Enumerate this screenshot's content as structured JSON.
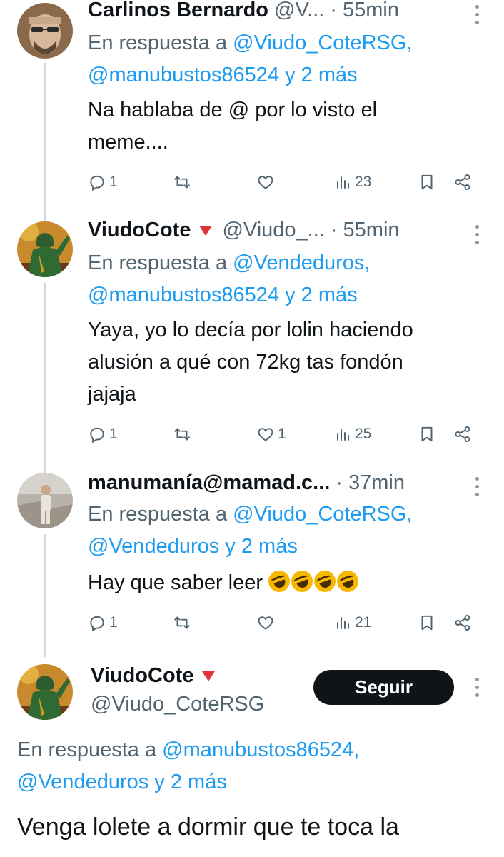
{
  "tweets": [
    {
      "name": "Carlinos Bernardo",
      "handle": "@V...",
      "dot": "·",
      "time": "55min",
      "reply_prefix": "En respuesta a",
      "reply_mentions_1": "@Viudo_CoteRSG,",
      "reply_mentions_2": "@manubustos86524 y 2 más",
      "text_1": "Na hablaba de @ por lo visto el",
      "text_2": "meme....",
      "replies": "1",
      "retweets": "",
      "likes": "",
      "views": "23"
    },
    {
      "name": "ViudoCote",
      "handle": "@Viudo_...",
      "dot": "·",
      "time": "55min",
      "reply_prefix": "En respuesta a",
      "reply_mentions_1": "@Vendeduros,",
      "reply_mentions_2": "@manubustos86524 y 2 más",
      "text_1": "Yaya, yo lo decía por lolin haciendo",
      "text_2": "alusión a qué con 72kg tas fondón",
      "text_3": "jajaja",
      "replies": "1",
      "retweets": "",
      "likes": "1",
      "views": "25"
    },
    {
      "name": "manumanía@mamad.c...",
      "dot": "·",
      "time": "37min",
      "reply_prefix": "En respuesta a",
      "reply_mentions_1": "@Viudo_CoteRSG,",
      "reply_mentions_2": "@Vendeduros y 2 más",
      "text_1": "Hay que saber leer",
      "emoji_count": 4,
      "replies": "1",
      "retweets": "",
      "likes": "",
      "views": "21"
    }
  ],
  "main_tweet": {
    "name": "ViudoCote",
    "handle": "@Viudo_CoteRSG",
    "follow_label": "Seguir",
    "reply_prefix": "En respuesta a",
    "reply_mentions_1": "@manubustos86524,",
    "reply_mentions_2": "@Vendeduros y 2 más",
    "text": "Venga lolete a dormir que te toca la"
  },
  "colors": {
    "link": "#1d9bf0",
    "secondary_text": "#536471",
    "badge": "#e0333b",
    "thread_line": "#cfd9de"
  },
  "icons": [
    "reply-icon",
    "retweet-icon",
    "like-icon",
    "views-icon",
    "bookmark-icon",
    "share-icon",
    "more-icon",
    "verified-triangle-icon"
  ]
}
